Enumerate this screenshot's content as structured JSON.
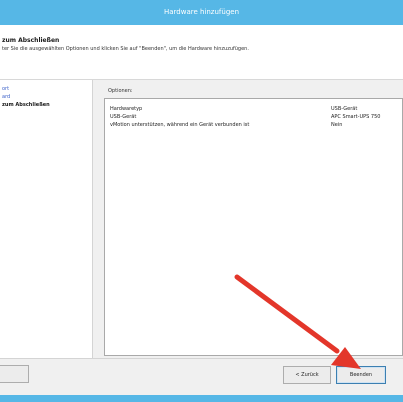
{
  "window": {
    "title": "Hardware hinzufügen"
  },
  "header": {
    "heading": "zum Abschließen",
    "subtext": "ter Sie die ausgewählten Optionen und klicken Sie auf \"Beenden\", um die Hardware hinzuzufügen."
  },
  "nav": {
    "items": [
      {
        "label": "ort"
      },
      {
        "label": "ard"
      },
      {
        "label": "zum Abschließen"
      }
    ]
  },
  "options": {
    "label": "Optionen:",
    "rows": [
      {
        "key": "Hardwaretyp",
        "value": "USB-Gerät"
      },
      {
        "key": "USB-Gerät",
        "value": "APC Smart-UPS 750"
      },
      {
        "key": "vMotion unterstützen, während ein Gerät verbunden ist",
        "value": "Nein"
      }
    ]
  },
  "buttons": {
    "left_label": "",
    "back_label": "< Zurück",
    "finish_label": "Beenden"
  },
  "annotation": {
    "arrow_color": "#e3362a"
  }
}
